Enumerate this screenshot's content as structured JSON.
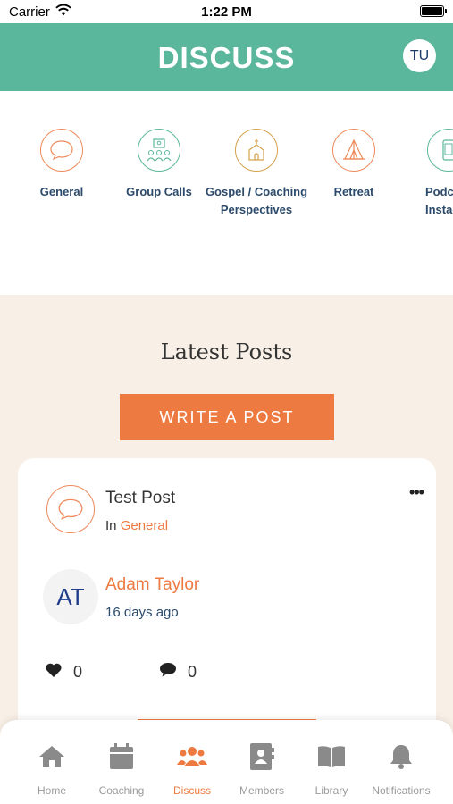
{
  "status_bar": {
    "carrier": "Carrier",
    "time": "1:22 PM"
  },
  "header": {
    "title": "DISCUSS",
    "avatar_initials": "TU"
  },
  "categories": [
    {
      "label": "General",
      "icon": "speech-bubble-icon",
      "color": "#ed8a5b"
    },
    {
      "label": "Group Calls",
      "icon": "group-call-icon",
      "color": "#5bb79c"
    },
    {
      "label": "Gospel / Coaching Perspectives",
      "icon": "church-icon",
      "color": "#d6a24b"
    },
    {
      "label": "Retreat",
      "icon": "tent-icon",
      "color": "#ed8a5b"
    },
    {
      "label": "Podca Instag",
      "icon": "phone-icon",
      "color": "#5bb79c"
    }
  ],
  "feed": {
    "heading": "Latest Posts",
    "write_button": "WRITE A POST"
  },
  "post": {
    "title": "Test Post",
    "in_prefix": "In",
    "category": "General",
    "author_initials": "AT",
    "author_name": "Adam Taylor",
    "date": "16 days ago",
    "likes": "0",
    "comments": "0"
  },
  "tabs": [
    {
      "label": "Home",
      "icon": "home-icon",
      "active": false
    },
    {
      "label": "Coaching",
      "icon": "calendar-icon",
      "active": false
    },
    {
      "label": "Discuss",
      "icon": "people-icon",
      "active": true
    },
    {
      "label": "Members",
      "icon": "contacts-icon",
      "active": false
    },
    {
      "label": "Library",
      "icon": "book-icon",
      "active": false
    },
    {
      "label": "Notifications",
      "icon": "bell-icon",
      "active": false
    }
  ],
  "colors": {
    "accent": "#ed7a40",
    "header": "#5bb79c",
    "feed_bg": "#f8efe6",
    "navy": "#2c4a6b"
  }
}
